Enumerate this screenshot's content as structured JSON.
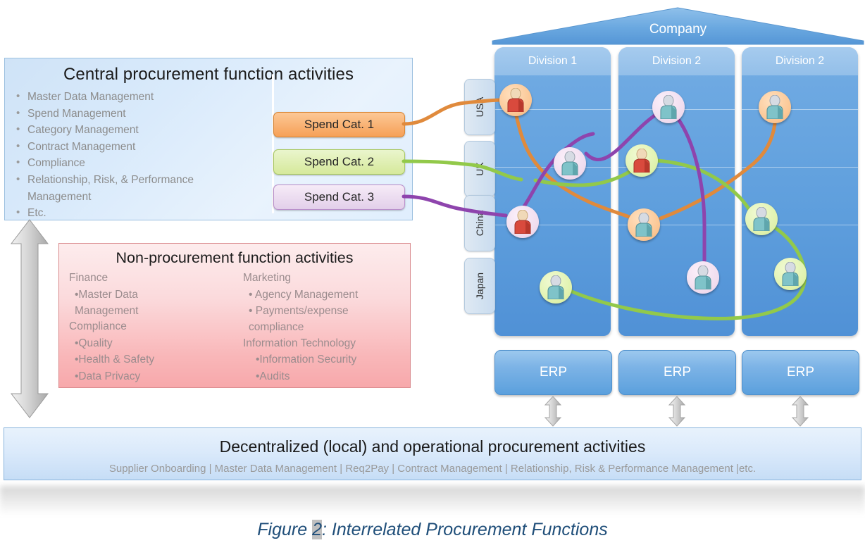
{
  "central": {
    "title": "Central procurement function activities",
    "bullets": [
      "Master Data Management",
      "Spend Management",
      "Category Management",
      "Contract Management",
      "Compliance",
      "Relationship, Risk, & Performance\nManagement",
      "Etc."
    ],
    "bullet_marker": "•"
  },
  "spend_categories": [
    {
      "label": "Spend Cat. 1",
      "color": "#e08a3c"
    },
    {
      "label": "Spend Cat. 2",
      "color": "#92c94a"
    },
    {
      "label": "Spend Cat. 3",
      "color": "#8e44ad"
    }
  ],
  "nonproc": {
    "title": "Non-procurement function activities",
    "left": {
      "head1": "Finance",
      "items1": [
        "•Master Data\n  Management"
      ],
      "head2": "Compliance",
      "items2": [
        "•Quality",
        "•Health & Safety",
        "•Data Privacy"
      ]
    },
    "right": {
      "head1": "Marketing",
      "items1": [
        "• Agency Management",
        "• Payments/expense compliance"
      ],
      "head2": "Information Technology",
      "items2": [
        "•Information Security",
        "•Audits"
      ]
    }
  },
  "company": {
    "roof_label": "Company",
    "divisions": [
      "Division 1",
      "Division 2",
      "Division 2"
    ],
    "countries": [
      "USA",
      "UK",
      "China",
      "Japan"
    ],
    "erp_label": "ERP",
    "erp_boxes": [
      "ERP",
      "ERP",
      "ERP"
    ]
  },
  "people": [
    {
      "halo": "orange",
      "shirt": "red",
      "div": 1,
      "country": "USA"
    },
    {
      "halo": "lavender",
      "shirt": "teal",
      "div": 2,
      "country": "USA"
    },
    {
      "halo": "orange",
      "shirt": "teal",
      "div": 3,
      "country": "USA"
    },
    {
      "halo": "lavender",
      "shirt": "teal",
      "div": 1,
      "country": "UK"
    },
    {
      "halo": "green",
      "shirt": "red",
      "div": 2,
      "country": "UK"
    },
    {
      "halo": "lavender",
      "shirt": "red",
      "div": 1,
      "country": "China"
    },
    {
      "halo": "orange",
      "shirt": "teal",
      "div": 2,
      "country": "China"
    },
    {
      "halo": "green",
      "shirt": "teal",
      "div": 3,
      "country": "China"
    },
    {
      "halo": "green",
      "shirt": "teal",
      "div": 1,
      "country": "Japan"
    },
    {
      "halo": "lavender",
      "shirt": "teal",
      "div": 2,
      "country": "Japan"
    },
    {
      "halo": "green",
      "shirt": "teal",
      "div": 3,
      "country": "Japan"
    }
  ],
  "decentralized": {
    "title": "Decentralized (local) and operational procurement activities",
    "subtitle": "Supplier Onboarding  |  Master Data Management  |  Req2Pay  |  Contract Management  |  Relationship, Risk & Performance Management  |etc."
  },
  "caption": {
    "pre": "Figure ",
    "number": "2",
    "post": ": Interrelated Procurement Functions"
  },
  "colors": {
    "cat1": "#e08a3c",
    "cat2": "#92c94a",
    "cat3": "#8e44ad",
    "division_blue": "#5f9fdd",
    "accent_caption": "#1f4e79"
  }
}
